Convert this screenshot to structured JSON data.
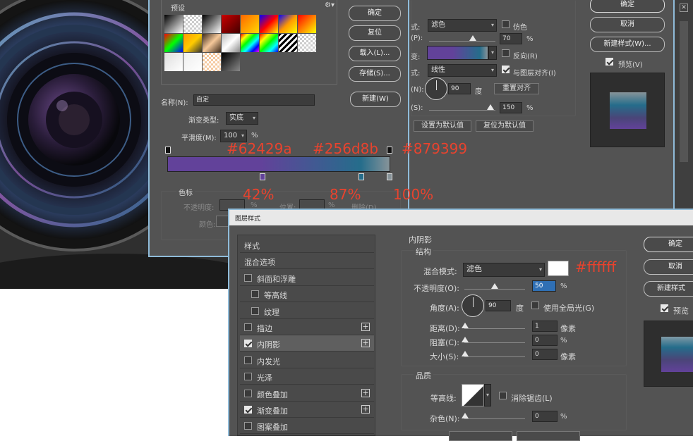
{
  "gradient_editor": {
    "presets_label": "预设",
    "name_label": "名称(N):",
    "name_value": "自定",
    "new_button": "新建(W)",
    "gradient_type_label": "渐变类型:",
    "gradient_type_value": "实底",
    "smoothness_label": "平滑度(M):",
    "smoothness_value": "100",
    "percent_sign": "%",
    "color_stops_label": "色标",
    "opacity_label": "不透明度:",
    "location_label": "位置:",
    "delete_label": "删除(D)",
    "color_label": "颜色:",
    "buttons": {
      "ok": "确定",
      "reset": "复位",
      "load": "载入(L)...",
      "save": "存储(S)..."
    },
    "colors": {
      "stop1": "#62429a",
      "stop2": "#256d8b",
      "stop3": "#879399"
    }
  },
  "gradient_overlay_panel": {
    "blend_mode_label": "式:",
    "blend_mode_value": "滤色",
    "dither_label": "仿色",
    "opacity_label": "(P):",
    "opacity_value": "70",
    "gradient_label": "变:",
    "reverse_label": "反向(R)",
    "style_label": "式:",
    "style_value": "线性",
    "align_label": "与图层对齐(I)",
    "angle_label": "(N):",
    "angle_value": "90",
    "degree_sign": "度",
    "reset_alignment": "重置对齐",
    "scale_label": "(S):",
    "scale_value": "150",
    "percent_sign": "%",
    "set_default": "设置为默认值",
    "reset_default": "复位为默认值",
    "ok": "确定",
    "cancel": "取消",
    "new_style": "新建样式(W)...",
    "preview": "预览(V)"
  },
  "annotations": {
    "hex1": "#62429a",
    "hex2": "#256d8b",
    "hex3": "#879399",
    "pct1": "42%",
    "pct2": "87%",
    "pct3": "100%",
    "white_hex": "#ffffff"
  },
  "layer_style": {
    "title": "图层样式",
    "sidebar": [
      {
        "label": "样式",
        "checkbox": false,
        "checked": false,
        "plus": false,
        "indent": false
      },
      {
        "label": "混合选项",
        "checkbox": false,
        "checked": false,
        "plus": false,
        "indent": false
      },
      {
        "label": "斜面和浮雕",
        "checkbox": true,
        "checked": false,
        "plus": false,
        "indent": false
      },
      {
        "label": "等高线",
        "checkbox": true,
        "checked": false,
        "plus": false,
        "indent": true
      },
      {
        "label": "纹理",
        "checkbox": true,
        "checked": false,
        "plus": false,
        "indent": true
      },
      {
        "label": "描边",
        "checkbox": true,
        "checked": false,
        "plus": true,
        "indent": false
      },
      {
        "label": "内阴影",
        "checkbox": true,
        "checked": true,
        "plus": true,
        "indent": false
      },
      {
        "label": "内发光",
        "checkbox": true,
        "checked": false,
        "plus": false,
        "indent": false
      },
      {
        "label": "光泽",
        "checkbox": true,
        "checked": false,
        "plus": false,
        "indent": false
      },
      {
        "label": "颜色叠加",
        "checkbox": true,
        "checked": false,
        "plus": true,
        "indent": false
      },
      {
        "label": "渐变叠加",
        "checkbox": true,
        "checked": true,
        "plus": true,
        "indent": false
      },
      {
        "label": "图案叠加",
        "checkbox": true,
        "checked": false,
        "plus": false,
        "indent": false
      }
    ],
    "inner_shadow": {
      "section_title": "内阴影",
      "structure_title": "结构",
      "blend_mode_label": "混合模式:",
      "blend_mode_value": "滤色",
      "opacity_label": "不透明度(O):",
      "opacity_value": "50",
      "angle_label": "角度(A):",
      "angle_value": "90",
      "degree_sign": "度",
      "global_light_label": "使用全局光(G)",
      "distance_label": "距离(D):",
      "distance_value": "1",
      "choke_label": "阻塞(C):",
      "choke_value": "0",
      "size_label": "大小(S):",
      "size_value": "0",
      "pixel_unit": "像素",
      "percent_sign": "%",
      "quality_title": "品质",
      "contour_label": "等高线:",
      "antialias_label": "消除锯齿(L)",
      "noise_label": "杂色(N):",
      "noise_value": "0",
      "color": "#ffffff"
    },
    "buttons": {
      "ok": "确定",
      "cancel": "取消",
      "new_style": "新建样式",
      "preview": "预览"
    }
  }
}
